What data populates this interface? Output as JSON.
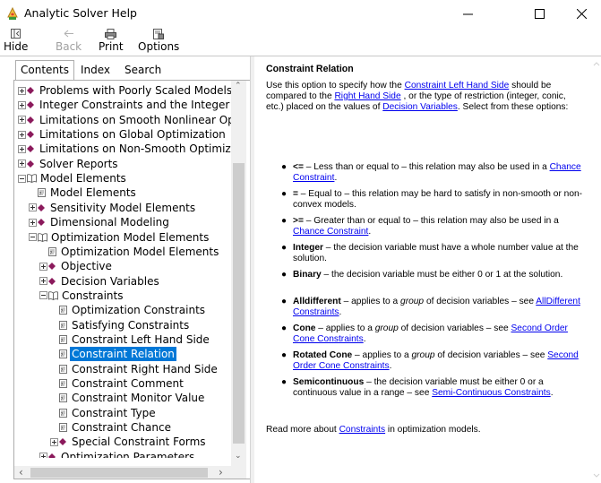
{
  "window": {
    "title": "Analytic Solver Help",
    "minimize_glyph": "—",
    "maximize_glyph": "☐",
    "close_glyph": "✕"
  },
  "toolbar": {
    "hide_label": "Hide",
    "back_label": "Back",
    "print_label": "Print",
    "options_label": "Options"
  },
  "tabs": {
    "contents": "Contents",
    "index": "Index",
    "search": "Search"
  },
  "tree": {
    "items": [
      {
        "label": "Problems with Poorly Scaled Models",
        "kind": "book",
        "expander": "plus",
        "indent": 0
      },
      {
        "label": "Integer Constraints and the Integer Op",
        "kind": "book",
        "expander": "plus",
        "indent": 0
      },
      {
        "label": "Limitations on Smooth Nonlinear Opti",
        "kind": "book",
        "expander": "plus",
        "indent": 0
      },
      {
        "label": "Limitations on Global Optimization",
        "kind": "book",
        "expander": "plus",
        "indent": 0
      },
      {
        "label": "Limitations on Non-Smooth Optimizati",
        "kind": "book",
        "expander": "plus",
        "indent": 0
      },
      {
        "label": "Solver Reports",
        "kind": "book",
        "expander": "plus",
        "indent": 0
      },
      {
        "label": "Model Elements",
        "kind": "open-book",
        "expander": "minus",
        "indent": 0
      },
      {
        "label": "Model Elements",
        "kind": "page",
        "expander": "none",
        "indent": 1
      },
      {
        "label": "Sensitivity Model Elements",
        "kind": "book",
        "expander": "plus",
        "indent": 1
      },
      {
        "label": "Dimensional Modeling",
        "kind": "book",
        "expander": "plus",
        "indent": 1
      },
      {
        "label": "Optimization Model Elements",
        "kind": "open-book",
        "expander": "minus",
        "indent": 1
      },
      {
        "label": "Optimization Model Elements",
        "kind": "page",
        "expander": "none",
        "indent": 2
      },
      {
        "label": "Objective",
        "kind": "book",
        "expander": "plus",
        "indent": 2
      },
      {
        "label": "Decision Variables",
        "kind": "book",
        "expander": "plus",
        "indent": 2
      },
      {
        "label": "Constraints",
        "kind": "open-book",
        "expander": "minus",
        "indent": 2
      },
      {
        "label": "Optimization Constraints",
        "kind": "page",
        "expander": "none",
        "indent": 3
      },
      {
        "label": "Satisfying Constraints",
        "kind": "page",
        "expander": "none",
        "indent": 3
      },
      {
        "label": "Constraint Left Hand Side",
        "kind": "page",
        "expander": "none",
        "indent": 3
      },
      {
        "label": "Constraint Relation",
        "kind": "page",
        "expander": "none",
        "indent": 3,
        "selected": true
      },
      {
        "label": "Constraint Right Hand Side",
        "kind": "page",
        "expander": "none",
        "indent": 3
      },
      {
        "label": "Constraint Comment",
        "kind": "page",
        "expander": "none",
        "indent": 3
      },
      {
        "label": "Constraint Monitor Value",
        "kind": "page",
        "expander": "none",
        "indent": 3
      },
      {
        "label": "Constraint Type",
        "kind": "page",
        "expander": "none",
        "indent": 3
      },
      {
        "label": "Constraint Chance",
        "kind": "page",
        "expander": "none",
        "indent": 3
      },
      {
        "label": "Special Constraint Forms",
        "kind": "book",
        "expander": "plus",
        "indent": 3
      },
      {
        "label": "Optimization Parameters",
        "kind": "book",
        "expander": "plus",
        "indent": 2
      }
    ]
  },
  "topic": {
    "title": "Constraint Relation",
    "intro": {
      "t1": "Use this option to specify how the ",
      "l1": "Constraint Left Hand Side",
      "t2": " should be compared to the ",
      "l2": "Right Hand Side",
      "t3": " , or the type of restriction (integer, conic, etc.) placed on the values of ",
      "l3": "Decision Variables",
      "t4": ". Select from these options:"
    },
    "bullets": {
      "le": {
        "term": "<=",
        "text": " – Less than or equal to – this relation may also be used in a ",
        "link": "Chance Constraint",
        "end": "."
      },
      "eq": {
        "term": "=",
        "text": " – Equal to – this relation may be hard to satisfy in non-smooth or non-convex models."
      },
      "ge": {
        "term": ">=",
        "text": " – Greater than or equal to – this relation may also be used in a ",
        "link": "Chance Constraint",
        "end": "."
      },
      "integer": {
        "term": "Integer",
        "text": " – the decision variable must have a whole number value at the solution."
      },
      "binary": {
        "term": "Binary",
        "text": " – the decision variable must be either 0 or 1 at the solution."
      },
      "alldiff": {
        "term": "Alldifferent",
        "pre": " – applies to a ",
        "group": "group",
        "post": " of decision variables – see ",
        "link": "AllDifferent Constraints",
        "end": "."
      },
      "cone": {
        "term": "Cone",
        "pre": " – applies to a ",
        "group": "group",
        "post": " of decision variables – see ",
        "link": "Second Order Cone Constraints",
        "end": "."
      },
      "rcone": {
        "term": "Rotated Cone",
        "pre": " – applies to a ",
        "group": "group",
        "post": " of decision variables – see ",
        "link": "Second Order Cone Constraints",
        "end": "."
      },
      "semi": {
        "term": "Semicontinuous",
        "text": " – the decision variable must be either 0 or a continuous value in a range – see ",
        "link": "Semi-Continuous Constraints",
        "end": "."
      }
    },
    "bullet_glyph": "●",
    "read_more": {
      "pre": "Read more about ",
      "link": "Constraints",
      "post": " in optimization models."
    }
  },
  "colors": {
    "selection": "#0078d7",
    "link": "#0000ee",
    "book": "#8b1a5c"
  },
  "scroll_glyphs": {
    "up": "⌃",
    "down": "⌄",
    "left": "‹",
    "right": "›"
  },
  "icons": [
    "app-icon",
    "hide-icon",
    "back-icon",
    "print-icon",
    "options-icon",
    "book-icon",
    "open-book-icon",
    "page-icon"
  ]
}
